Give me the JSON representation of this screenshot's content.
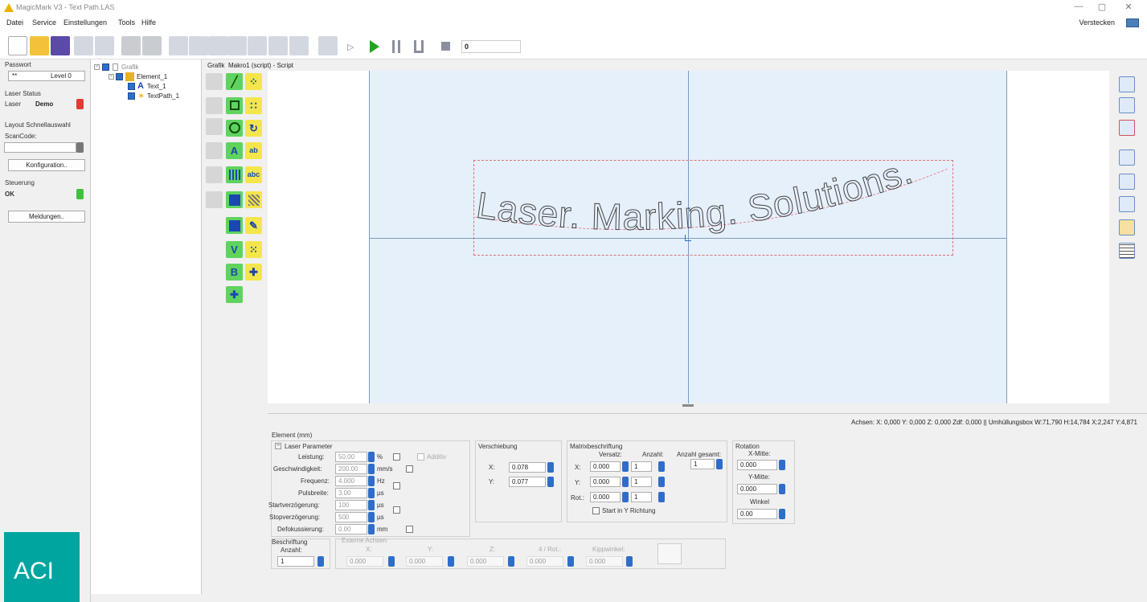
{
  "window": {
    "title": "MagicMark V3 - Text Path.LAS",
    "controls": {
      "minimize": "—",
      "maximize": "▢",
      "close": "✕"
    }
  },
  "menu": {
    "items": [
      "Datei",
      "Service",
      "Einstellungen",
      "Tools",
      "Hilfe"
    ],
    "verstecken": "Verstecken"
  },
  "toolbar": {
    "icons": [
      "new-file",
      "open-file",
      "save",
      "undo",
      "redo",
      "stop-square",
      "record",
      "move",
      "group",
      "ungroup",
      "combine",
      "matrix",
      "grid",
      "image",
      "target",
      "step",
      "play",
      "pause",
      "pause-alt",
      "stop"
    ],
    "zoom_value": "0"
  },
  "left_panel": {
    "password_label": "Passwort",
    "password_value": "**",
    "level": "Level 0",
    "laser_status_label": "Laser Status",
    "laser_label": "Laser",
    "laser_mode": "Demo",
    "laser_led_color": "#e53935",
    "layout_label": "Layout Schnellauswahl",
    "scancode_label": "ScanCode:",
    "konfiguration_button": "Konfiguration..",
    "steuerung_label": "Steuerung",
    "steuerung_status": "OK",
    "steuerung_led_color": "#3ec23e",
    "meldungen_button": "Meldungen..",
    "logo": "ACI"
  },
  "tree": {
    "root": "Grafik",
    "items": [
      {
        "label": "Element_1",
        "icon": "element-icon"
      },
      {
        "label": "Text_1",
        "icon": "text-icon"
      },
      {
        "label": "TextPath_1",
        "icon": "textpath-icon"
      }
    ]
  },
  "tabs": [
    "Grafik",
    "Makro1 (script) - Script"
  ],
  "canvas": {
    "text": "Laser. Marking. Solutions."
  },
  "status": {
    "text": "Achsen: X: 0,000  Y: 0,000  Z: 0,000  Zdf: 0,000  ||  Umhüllungsbox  W:71,790  H:14,784  X:2,247  Y:4,871"
  },
  "properties": {
    "title": "Element (mm)",
    "laser": {
      "title": "Laser Parameter",
      "additiv": "Additiv",
      "rows": [
        {
          "label": "Leistung:",
          "value": "50.00",
          "unit": "%"
        },
        {
          "label": "Geschwindigkeit:",
          "value": "200.00",
          "unit": "mm/s"
        },
        {
          "label": "Frequenz:",
          "value": "4.000",
          "unit": "Hz"
        },
        {
          "label": "Pulsbreite:",
          "value": "3.00",
          "unit": "µs"
        },
        {
          "label": "Startverzögerung:",
          "value": "100",
          "unit": "µs"
        },
        {
          "label": "Stopverzögerung:",
          "value": "500",
          "unit": "µs"
        },
        {
          "label": "Defokussierung:",
          "value": "0.00",
          "unit": "mm"
        }
      ]
    },
    "verschiebung": {
      "title": "Verschiebung",
      "x_label": "X:",
      "x": "0.078",
      "y_label": "Y:",
      "y": "0.077"
    },
    "matrix": {
      "title": "Matrixbeschriftung",
      "versatz": "Versatz:",
      "anzahl": "Anzahl:",
      "anzahl_gesamt": "Anzahl gesamt:",
      "anzahl_gesamt_value": "1",
      "x_label": "X:",
      "x": "0.000",
      "x_count": "1",
      "y_label": "Y:",
      "y": "0.000",
      "y_count": "1",
      "rot_label": "Rot.:",
      "rot": "0.000",
      "rot_count": "1",
      "start_y": "Start in Y Richtung"
    },
    "rotation": {
      "title": "Rotation",
      "xmitte": "X-Mitte:",
      "xmitte_value": "0.000",
      "ymitte": "Y-Mitte:",
      "ymitte_value": "0.000",
      "winkel": "Winkel",
      "winkel_value": "0.00"
    },
    "beschriftung": {
      "title": "Beschriftung",
      "anzahl": "Anzahl:",
      "anzahl_value": "1"
    },
    "externe": {
      "title": "Externe Achsen",
      "x": "X:",
      "x_value": "0.000",
      "y": "Y:",
      "y_value": "0.000",
      "z": "Z:",
      "z_value": "0.000",
      "rot": "4 / Rot.:",
      "rot_value": "0.000",
      "kipp": "Kippwinkel:",
      "kipp_value": "0.000"
    }
  }
}
